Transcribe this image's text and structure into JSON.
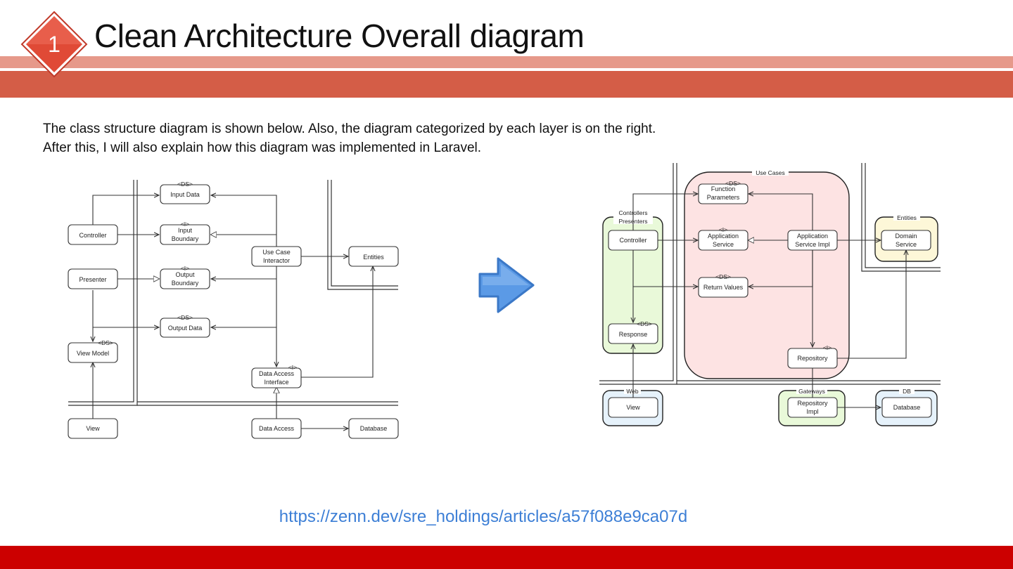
{
  "slide": {
    "number": "1",
    "title": "Clean Architecture Overall diagram",
    "intro_line1": "The class structure diagram is shown below. Also, the diagram categorized by each layer is on the right.",
    "intro_line2": "After this, I will also explain how this diagram was implemented in Laravel.",
    "link": "https://zenn.dev/sre_holdings/articles/a57f088e9ca07d",
    "colors": {
      "accent": "#d45d47",
      "accent_light": "#e6998a",
      "footer": "#cc0000",
      "link": "#3d7fd6",
      "arrow": "#5b9ae6"
    }
  },
  "left_diagram": {
    "boxes": {
      "input_data": "Input Data",
      "input_boundary_l1": "Input",
      "input_boundary_l2": "Boundary",
      "output_boundary_l1": "Output",
      "output_boundary_l2": "Boundary",
      "output_data": "Output Data",
      "controller": "Controller",
      "presenter": "Presenter",
      "view_model": "View Model",
      "view": "View",
      "use_case_l1": "Use Case",
      "use_case_l2": "Interactor",
      "entities": "Entities",
      "dai_l1": "Data Access",
      "dai_l2": "Interface",
      "data_access": "Data Access",
      "database": "Database"
    },
    "stereotypes": {
      "ds": "<DS>",
      "i": "<I>"
    }
  },
  "right_diagram": {
    "groups": {
      "use_cases": "Use Cases",
      "controllers_l1": "Controllers",
      "controllers_l2": "Presenters",
      "entities": "Entities",
      "web": "Web",
      "gateways": "Gateways",
      "db": "DB"
    },
    "boxes": {
      "function_params_l1": "Function",
      "function_params_l2": "Parameters",
      "app_service_l1": "Application",
      "app_service_l2": "Service",
      "app_service_impl_l1": "Application",
      "app_service_impl_l2": "Service Impl",
      "return_values": "Return Values",
      "controller": "Controller",
      "response": "Response",
      "domain_service_l1": "Domain",
      "domain_service_l2": "Service",
      "repository": "Repository",
      "view": "View",
      "repo_impl_l1": "Repository",
      "repo_impl_l2": "Impl",
      "database": "Database"
    },
    "stereotypes": {
      "ds": "<DS>",
      "i": "<I>"
    },
    "colors": {
      "use_cases_fill": "#fde3e3",
      "controllers_fill": "#e9f9d9",
      "entities_fill": "#fdf7d8",
      "web_fill": "#e6f2fb",
      "gateways_fill": "#e9f9d9",
      "db_fill": "#e6f2fb"
    }
  }
}
